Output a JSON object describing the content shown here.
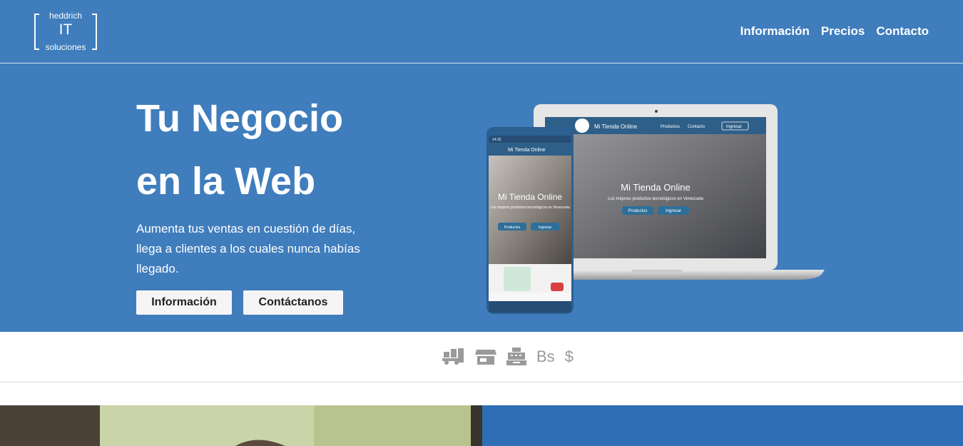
{
  "header": {
    "logo": {
      "top": "heddrich",
      "middle": "IT",
      "bottom": "soluciones"
    },
    "nav": [
      "Información",
      "Precios",
      "Contacto"
    ]
  },
  "hero": {
    "title_line1": "Tu Negocio",
    "title_line2": "en la Web",
    "subtitle": "Aumenta tus ventas en cuestión de días, llega a clientes a los cuales nunca habías llegado.",
    "buttons": {
      "info": "Información",
      "contact": "Contáctanos"
    },
    "mockup": {
      "laptop": {
        "brand": "Mi Tienda Online",
        "nav": [
          "Productos",
          "Contacto"
        ],
        "login": "Ingresar",
        "heading": "Mi Tienda Online",
        "tagline": "Los mejores productos tecnológicos en Venezuela",
        "buttons": [
          "Productos",
          "Ingresar"
        ]
      },
      "phone": {
        "time": "14:32",
        "brand": "Mi Tienda Online",
        "heading": "Mi Tienda Online",
        "tagline": "Los mejores productos tecnológicos en Venezuela",
        "buttons": [
          "Productos",
          "Ingresar"
        ]
      }
    }
  },
  "payments": {
    "icons": [
      "truck-icon",
      "store-icon",
      "cash-register-icon",
      "bolivar-icon",
      "dollar-icon"
    ],
    "bolivar": "Bs",
    "dollar": "$"
  },
  "colors": {
    "hero_bg": "#3f7dbd",
    "lower_right_bg": "#2f6db5",
    "icon_gray": "#9a9a9a"
  }
}
